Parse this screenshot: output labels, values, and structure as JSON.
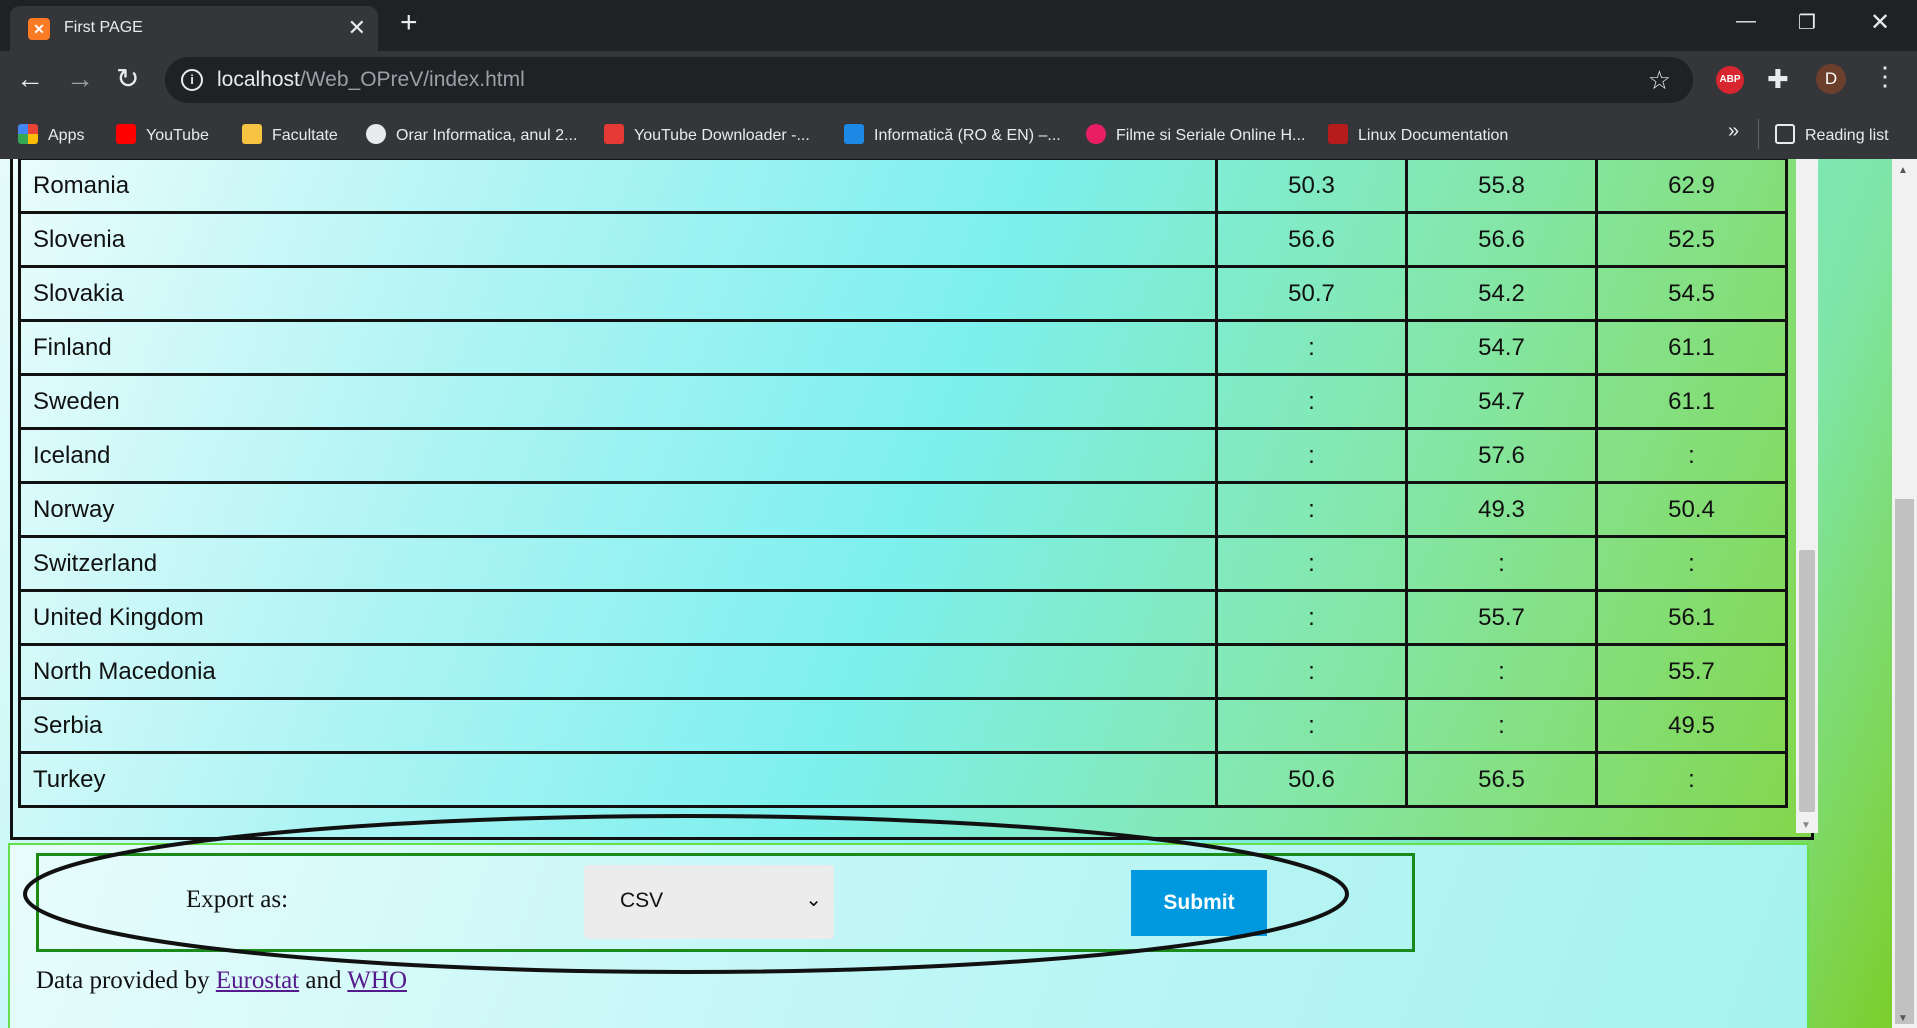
{
  "browser": {
    "tab_title": "First PAGE",
    "url_host": "localhost",
    "url_path": "/Web_OPreV/index.html",
    "bookmarks": [
      {
        "label": "Apps",
        "color": "#4285f4"
      },
      {
        "label": "YouTube",
        "color": "#ff0000"
      },
      {
        "label": "Facultate",
        "color": "#f6c343"
      },
      {
        "label": "Orar Informatica, anul 2...",
        "color": "#e8eaed"
      },
      {
        "label": "YouTube Downloader -...",
        "color": "#e53935"
      },
      {
        "label": "Informatică (RO & EN) –...",
        "color": "#1e88e5"
      },
      {
        "label": "Filme si Seriale Online H...",
        "color": "#e91e63"
      },
      {
        "label": "Linux Documentation",
        "color": "#b71c1c"
      }
    ],
    "reading_list": "Reading list",
    "profile_initial": "D",
    "abp_label": "ABP"
  },
  "table": {
    "rows": [
      {
        "country": "Romania",
        "v1": "50.3",
        "v2": "55.8",
        "v3": "62.9"
      },
      {
        "country": "Slovenia",
        "v1": "56.6",
        "v2": "56.6",
        "v3": "52.5"
      },
      {
        "country": "Slovakia",
        "v1": "50.7",
        "v2": "54.2",
        "v3": "54.5"
      },
      {
        "country": "Finland",
        "v1": ":",
        "v2": "54.7",
        "v3": "61.1"
      },
      {
        "country": "Sweden",
        "v1": ":",
        "v2": "54.7",
        "v3": "61.1"
      },
      {
        "country": "Iceland",
        "v1": ":",
        "v2": "57.6",
        "v3": ":"
      },
      {
        "country": "Norway",
        "v1": ":",
        "v2": "49.3",
        "v3": "50.4"
      },
      {
        "country": "Switzerland",
        "v1": ":",
        "v2": ":",
        "v3": ":"
      },
      {
        "country": "United Kingdom",
        "v1": ":",
        "v2": "55.7",
        "v3": "56.1"
      },
      {
        "country": "North Macedonia",
        "v1": ":",
        "v2": ":",
        "v3": "55.7"
      },
      {
        "country": "Serbia",
        "v1": ":",
        "v2": ":",
        "v3": "49.5"
      },
      {
        "country": "Turkey",
        "v1": "50.6",
        "v2": "56.5",
        "v3": ":"
      }
    ]
  },
  "export": {
    "label": "Export as:",
    "selected_format": "CSV",
    "submit_label": "Submit"
  },
  "credits": {
    "prefix": "Data provided by ",
    "source1": "Eurostat",
    "conj": " and ",
    "source2": "WHO"
  }
}
